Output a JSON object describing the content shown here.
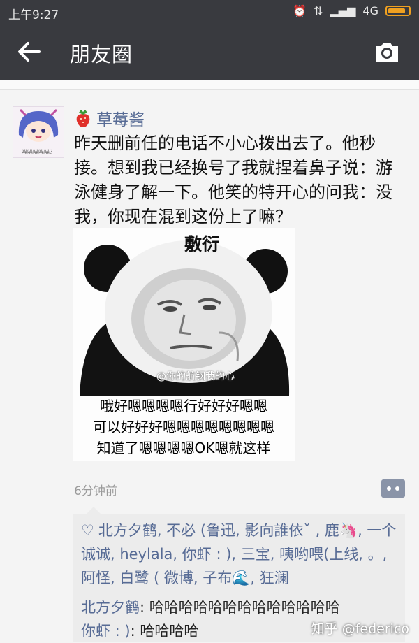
{
  "status_bar": {
    "time": "上午9:27",
    "network": "4G"
  },
  "nav": {
    "title": "朋友圈"
  },
  "post": {
    "author": "草莓酱",
    "avatar_caption": "喵喵喵喵喵？",
    "text": "昨天删前任的电话不小心拨出去了。他秒接。想到我已经换号了我就捏着鼻子说：游泳健身了解一下。他笑的特开心的问我：没我，你现在混到这份上了嘛？",
    "image": {
      "top_label": "敷衍",
      "watermark": "@你的航钢我的心",
      "caption_lines": [
        "哦好嗯嗯嗯嗯行好好好嗯嗯",
        "可以好好好嗯嗯嗯嗯嗯嗯嗯嗯",
        "知道了嗯嗯嗯嗯OK嗯就这样"
      ]
    },
    "time_ago": "6分钟前"
  },
  "likes": {
    "text": "北方夕鹤, 不必 (鲁迅, 影向誰依ˇ , 鹿🦄, 一个诚诚, heylala, 你虾 : ), 三宝, 咦哟喂(上线, 。, 阿怪, 白鹭 ( 微博, 子布🌊, 狂澜"
  },
  "comments": [
    {
      "author": "北方夕鹤",
      "text": "哈哈哈哈哈哈哈哈哈哈哈哈哈"
    },
    {
      "author": "你虾 : )",
      "text": "哈哈哈哈"
    }
  ],
  "watermark": "知乎 @federico",
  "colors": {
    "bar": "#393a3f",
    "link": "#576b95"
  }
}
